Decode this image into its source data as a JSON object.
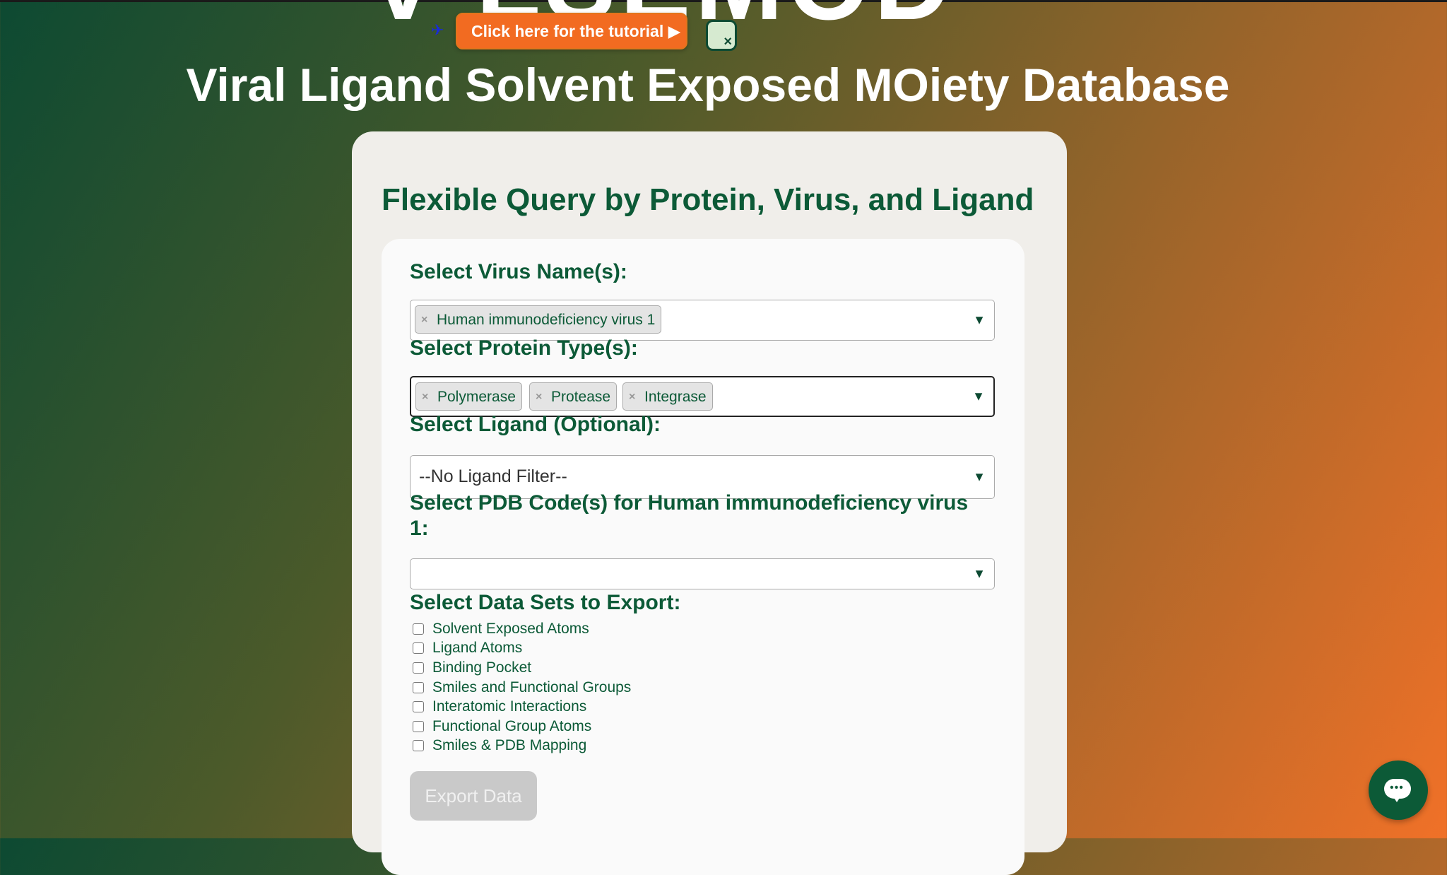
{
  "header": {
    "big_title": "V-LSEMOD",
    "subtitle": "Viral Ligand Solvent Exposed MOiety Database"
  },
  "tutorial": {
    "arrow_icon": "plane-icon",
    "button_label": "Click here for the tutorial ▶",
    "close_symbol": "×"
  },
  "card": {
    "title": "Flexible Query by Protein, Virus, and Ligand"
  },
  "form": {
    "virus_label": "Select Virus Name(s):",
    "virus_selected": [
      {
        "label": "Human immunodeficiency virus 1",
        "remove": "×"
      }
    ],
    "protein_label": "Select Protein Type(s):",
    "protein_selected": [
      {
        "label": "Polymerase",
        "remove": "×"
      },
      {
        "label": "Protease",
        "remove": "×"
      },
      {
        "label": "Integrase",
        "remove": "×"
      }
    ],
    "ligand_label": "Select Ligand (Optional):",
    "ligand_value": "--No Ligand Filter--",
    "pdb_label_line1": "Select PDB Code(s) for Human immunodeficiency virus",
    "pdb_label_line2": "1:",
    "pdb_value": "",
    "caret": "▼",
    "export_label": "Select Data Sets to Export:",
    "datasets": [
      {
        "label": "Solvent Exposed Atoms",
        "checked": false
      },
      {
        "label": "Ligand Atoms",
        "checked": false
      },
      {
        "label": "Binding Pocket",
        "checked": false
      },
      {
        "label": "Smiles and Functional Groups",
        "checked": false
      },
      {
        "label": "Interatomic Interactions",
        "checked": false
      },
      {
        "label": "Functional Group Atoms",
        "checked": false
      },
      {
        "label": "Smiles & PDB Mapping",
        "checked": false
      }
    ],
    "export_button": "Export Data"
  },
  "chat": {
    "icon": "chat-bubble-icon",
    "dots": "•••"
  },
  "colors": {
    "accent_green": "#0c5a37",
    "tutorial_orange": "#f26b21",
    "disabled_button": "#c9c9c9"
  }
}
